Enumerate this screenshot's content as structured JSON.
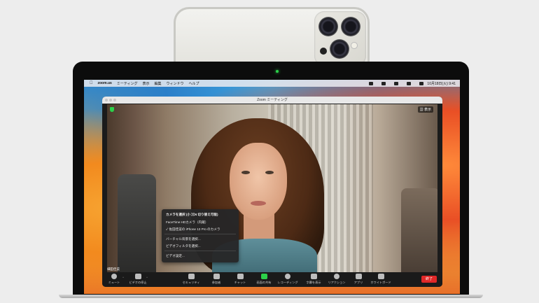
{
  "menubar": {
    "app": "zoom.us",
    "items": [
      "ミーティング",
      "表示",
      "編集",
      "ウィンドウ",
      "ヘルプ"
    ],
    "clock": "10月18日(火)  9:41"
  },
  "window": {
    "title": "Zoom ミーティング",
    "view_label": "表示"
  },
  "participant_name": "細田佳菜",
  "camera_menu": {
    "header": "カメラを選択 (小 ⌘N 切り替え可能)",
    "items": [
      "FaceTime HDカメラ（内蔵）",
      "✓ 佐田佳菜の iPhone 13 Pro のカメラ",
      "バーチャル背景を選択...",
      "ビデオフィルタを選択...",
      "ビデオ設定..."
    ]
  },
  "toolbar": {
    "mute": "ミュート",
    "video": "ビデオの停止",
    "security": "セキュリティ",
    "participants": "参加者",
    "chat": "チャット",
    "share": "画面の共有",
    "record": "レコーディング",
    "captions": "字幕を表示",
    "reactions": "リアクション",
    "apps": "アプリ",
    "whiteboard": "ホワイトボード",
    "end": "終了"
  },
  "colors": {
    "accent_green": "#2bd14a",
    "end_red": "#e02828"
  }
}
